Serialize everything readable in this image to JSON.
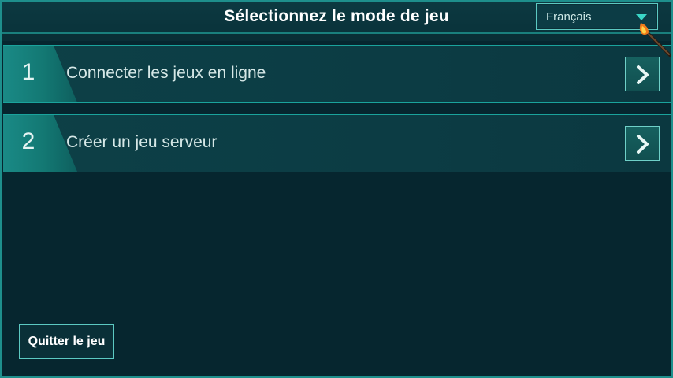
{
  "header": {
    "title": "Sélectionnez le mode de jeu"
  },
  "language_select": {
    "value": "Français",
    "icon": "chevron-down-icon"
  },
  "modes": [
    {
      "number": "1",
      "label": "Connecter les jeux en ligne",
      "icon": "chevron-right-icon"
    },
    {
      "number": "2",
      "label": "Créer un jeu serveur",
      "icon": "chevron-right-icon"
    }
  ],
  "footer": {
    "quit_label": "Quitter le jeu"
  },
  "colors": {
    "background": "#06262f",
    "accent": "#1e8f8c",
    "accent_bright": "#3ad6c7",
    "text": "#d6e8e7"
  }
}
